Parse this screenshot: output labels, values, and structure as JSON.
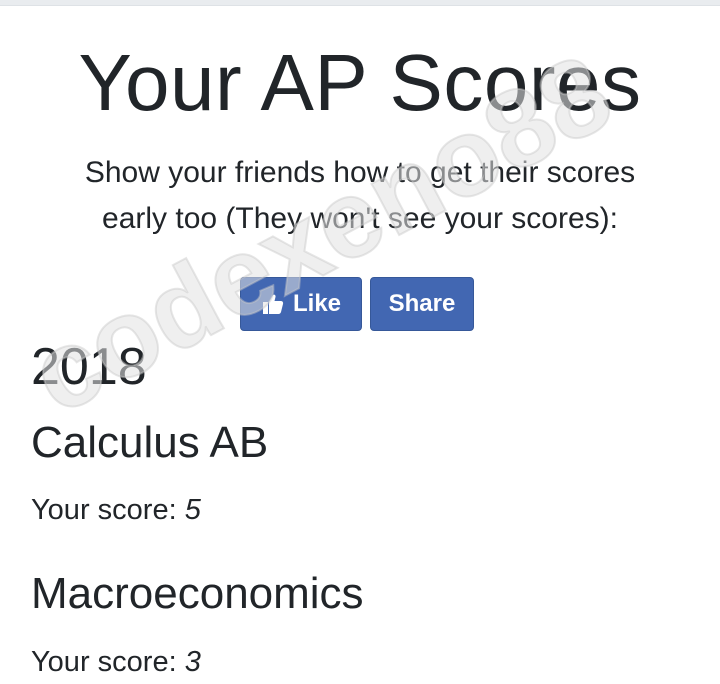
{
  "header": {
    "title": "Your AP Scores",
    "subtitle": "Show your friends how to get their scores early too (They won't see your scores):"
  },
  "social": {
    "like_label": "Like",
    "share_label": "Share",
    "brand_color": "#4267b2",
    "like_icon": "thumbs-up-icon"
  },
  "results": {
    "year": "2018",
    "exams": [
      {
        "subject": "Calculus AB",
        "score_label": "Your score:",
        "score": "5"
      },
      {
        "subject": "Macroeconomics",
        "score_label": "Your score:",
        "score": "3"
      }
    ]
  },
  "watermark": {
    "text": "codexeno88"
  }
}
